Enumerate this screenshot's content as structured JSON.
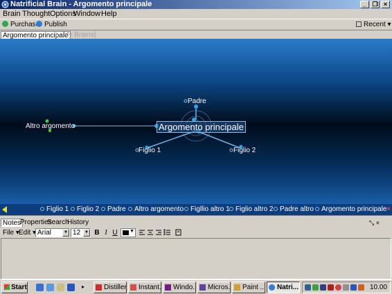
{
  "window": {
    "title": "Natrificial Brain - Argomento principale",
    "buttons": [
      "minimize",
      "restore",
      "close"
    ]
  },
  "menu": [
    "Brain",
    "Thought",
    "Options",
    "Window",
    "Help"
  ],
  "toolbar": {
    "purchase": "Purchase",
    "publish": "Publish",
    "recent": "Recent"
  },
  "brain_tabs": {
    "active": "Argomento principale",
    "inactive": "[...My Brains]"
  },
  "plex": {
    "central": "Argomento principale",
    "parent": "Padre",
    "jump": "Altro argomento",
    "child1": "Figlio 1",
    "child2": "Figlio 2"
  },
  "history": {
    "items": [
      "Figlio 1",
      "Figlio 2",
      "Padre",
      "Altro argomento",
      "Figllio altro 1",
      "Figlio altro 2",
      "Padre altro",
      "Argomento principale"
    ]
  },
  "notes": {
    "tabs": [
      "Notes",
      "Properties",
      "Search",
      "History"
    ],
    "file_menu": "File",
    "edit_menu": "Edit",
    "font": "Arial",
    "size": "12",
    "bold": "B",
    "italic": "I",
    "underline": "U"
  },
  "taskbar": {
    "start": "Start",
    "tasks": [
      "Distiller...",
      "Instant...",
      "Windo...",
      "Micros...",
      "Paint ...",
      "Natri..."
    ],
    "active_task": "Natri...",
    "clock": "10.00"
  },
  "colors": {
    "titlebar_start": "#0a246a",
    "titlebar_end": "#a6caf0",
    "node_blue": "#2ea6e6",
    "node_green": "#3ecf3e",
    "history_bg": "#0e3d7e"
  }
}
